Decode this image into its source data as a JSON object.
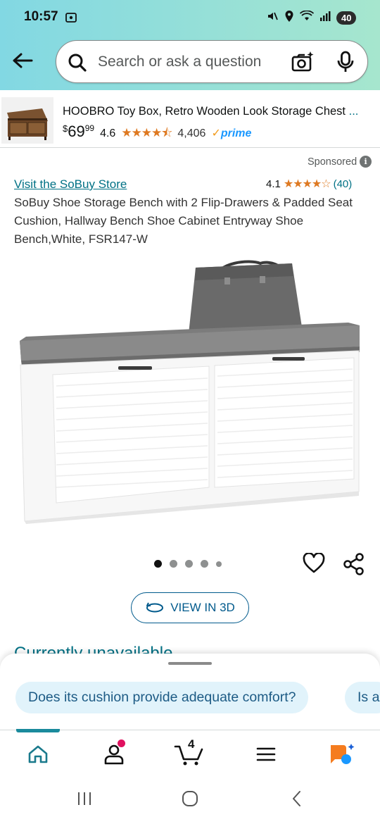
{
  "status_bar": {
    "time": "10:57",
    "battery": "40"
  },
  "search": {
    "placeholder": "Search or ask a question"
  },
  "sponsored_product": {
    "title": "HOOBRO Toy Box, Retro Wooden Look Storage Chest",
    "ellipsis": "...",
    "price_dollars": "69",
    "price_cents": "99",
    "currency": "$",
    "rating": "4.6",
    "stars": "★★★★⯪",
    "review_count": "4,406",
    "prime": "prime",
    "prime_check": "✓"
  },
  "sponsored_label": "Sponsored",
  "product": {
    "store_link": "Visit the SoBuy Store",
    "rating": "4.1",
    "stars": "★★★★☆",
    "review_count": "(40)",
    "title": "SoBuy Shoe Storage Bench with 2 Flip-Drawers & Padded Seat Cushion, Hallway Bench Shoe Cabinet Entryway Shoe Bench,White, FSR147-W"
  },
  "image_carousel": {
    "total_dots": 5,
    "active_index": 0
  },
  "view_3d_label": "VIEW IN 3D",
  "availability": "Currently unavailable",
  "suggestions": [
    "Does its cushion provide adequate comfort?",
    "Is a"
  ],
  "bottom_nav": {
    "cart_count": "4"
  },
  "colors": {
    "header_gradient_start": "#82d8e3",
    "header_gradient_end": "#a6e6ce",
    "link": "#007185",
    "star": "#de7921",
    "prime": "#1a98ff",
    "chip_bg": "#e1f3fb",
    "active_tab": "#1a8a9c"
  }
}
